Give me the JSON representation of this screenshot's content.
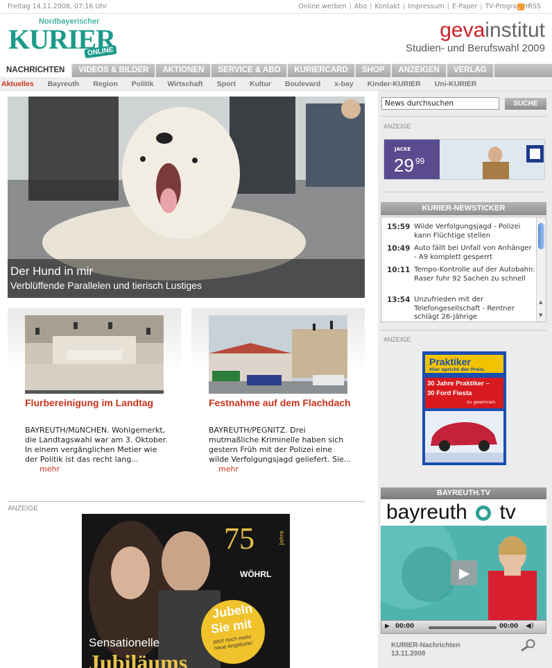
{
  "topbar": {
    "date": "Freitag 14.11.2008, 07:16 Uhr",
    "links": [
      "Online werben",
      "Abo",
      "Kontakt",
      "Impressum",
      "E-Paper",
      "TV-Programm"
    ],
    "rss_label": "RSS"
  },
  "logo": {
    "sub": "Nordbayerischer",
    "main": "KURIER",
    "online": "ONLINE"
  },
  "geva": {
    "brand_a": "geva",
    "brand_b": "institut",
    "tagline": "Studien- und Berufswahl 2009"
  },
  "nav": {
    "items": [
      "NACHRICHTEN",
      "VIDEOS & BILDER",
      "AKTIONEN",
      "SERVICE & ABO",
      "KURIERCARD",
      "SHOP",
      "ANZEIGEN",
      "VERLAG"
    ]
  },
  "subnav": {
    "items": [
      "Aktuelles",
      "Bayreuth",
      "Region",
      "Politik",
      "Wirtschaft",
      "Sport",
      "Kultur",
      "Boulevard",
      "x-bay",
      "Kinder-KURIER",
      "Uni-KURIER"
    ]
  },
  "hero": {
    "title": "Der Hund in mir",
    "subtitle": "Verblüffende Parallelen und tierisch Lustiges"
  },
  "teasers": [
    {
      "title": "Flurbereinigung im Landtag",
      "text": "BAYREUTH/MüNCHEN. Wohlgemerkt, die Landtagswahl war am 3. Oktober. In einem vergänglichen Metier wie der Politik ist das recht lang...",
      "more": "mehr"
    },
    {
      "title": "Festnahme auf dem Flachdach",
      "text": "BAYREUTH/PEGNITZ. Drei mutmaßliche Kriminelle haben sich gestern Früh mit der Polizei eine wilde Verfolgungsjagd geliefert. Sie...",
      "more": "mehr"
    }
  ],
  "ad_label": "ANZEIGE",
  "bigad": {
    "jubiläum": "75",
    "jahre": "Jahre",
    "brand": "WÖHRL",
    "badge1": "Jubeln",
    "badge2": "Sie mit",
    "badge3": "Jetzt noch mehr neue Angebote!",
    "line1": "Sensationelle",
    "line2": "Jubiläums"
  },
  "search": {
    "placeholder": "News durchsuchen",
    "button": "SUCHE"
  },
  "jacke_ad": {
    "label": "JACKE",
    "price": "29",
    "cents": "99"
  },
  "ticker": {
    "title": "KURIER-NEWSTICKER",
    "items": [
      {
        "time": "15:59",
        "text": "Wilde Verfolgungsjagd - Polizei kann Flüchtige stellen"
      },
      {
        "time": "10:49",
        "text": "Auto fällt bei Unfall von Anhänger - A9 komplett gesperrt"
      },
      {
        "time": "10:11",
        "text": "Tempo-Kontrolle auf der Autobahn: Raser fuhr 92 Sachen zu schnell"
      },
      {
        "time": "13:54",
        "text": "Unzufrieden mit der Telefongesellschaft - Rentner schlägt 26-Jährige"
      }
    ]
  },
  "praktiker": {
    "brand": "Praktiker",
    "claim": "Hier spricht der Preis.",
    "headline1": "30 Jahre Praktiker –",
    "headline2": "30 Ford Fiesta",
    "headline3": "zu gewinnen"
  },
  "bayreuthtv": {
    "title": "BAYREUTH.TV",
    "logo_a": "bayreuth",
    "logo_b": "tv",
    "time_left": "00:00",
    "time_right": "00:00",
    "caption1": "KURIER-Nachrichten",
    "caption2": "13.11.2008"
  },
  "colors": {
    "accent": "#c8331c",
    "logo_teal": "#1c9a8a",
    "geva_red": "#d01e28",
    "praktiker_blue": "#1a4fb0"
  }
}
